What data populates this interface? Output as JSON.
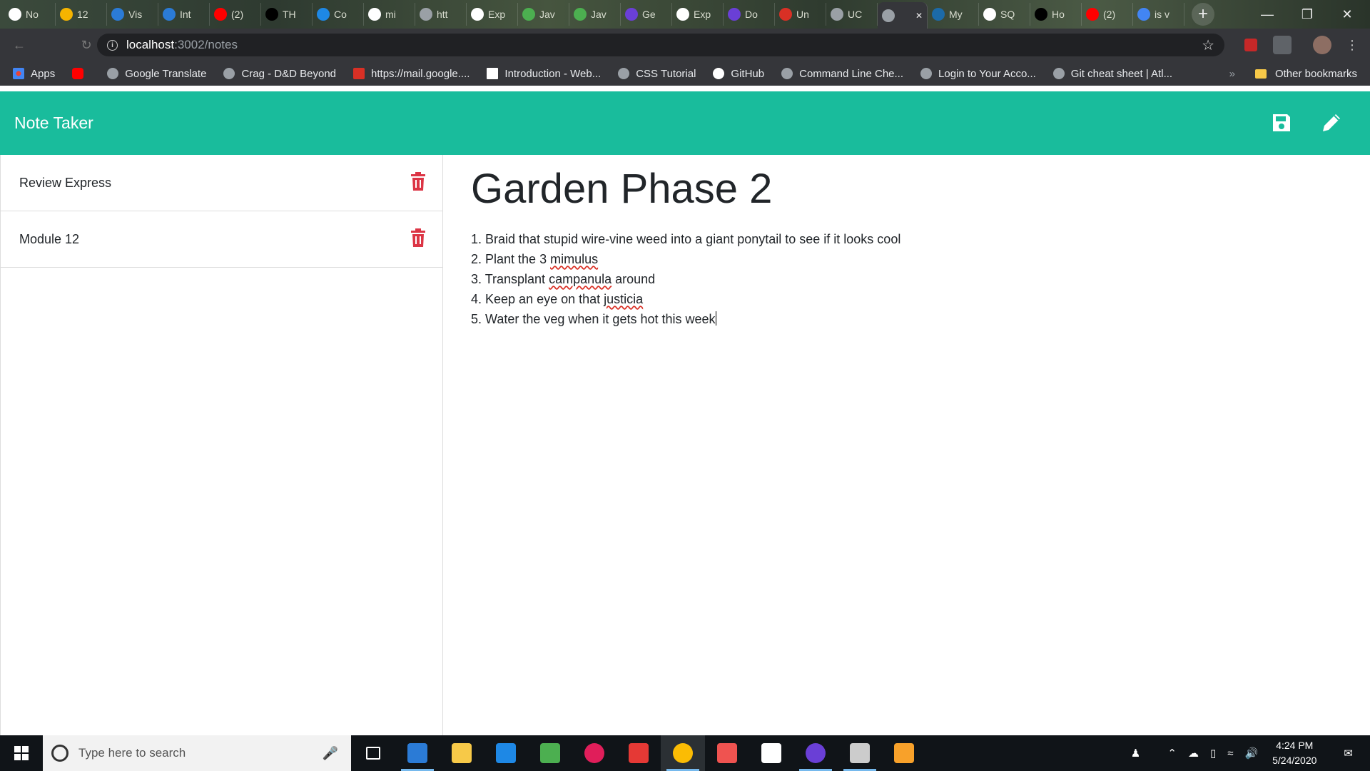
{
  "browser": {
    "tabs": [
      {
        "label": "No",
        "icon": "github-icon",
        "color": "#ffffff"
      },
      {
        "label": "12",
        "icon": "emoji-icon",
        "color": "#f5b400"
      },
      {
        "label": "Vis",
        "icon": "vscode-icon",
        "color": "#2b7bd6"
      },
      {
        "label": "Int",
        "icon": "vscode-icon",
        "color": "#2b7bd6"
      },
      {
        "label": "(2)",
        "icon": "youtube-icon",
        "color": "#ff0000"
      },
      {
        "label": "TH",
        "icon": "medium-icon",
        "color": "#000000"
      },
      {
        "label": "Co",
        "icon": "vuetify-icon",
        "color": "#1e88e5"
      },
      {
        "label": "mi",
        "icon": "github-icon",
        "color": "#ffffff"
      },
      {
        "label": "htt",
        "icon": "globe-icon",
        "color": "#9aa0a6"
      },
      {
        "label": "Exp",
        "icon": "express-icon",
        "color": "#ffffff"
      },
      {
        "label": "Jav",
        "icon": "w3-icon",
        "color": "#4caf50"
      },
      {
        "label": "Jav",
        "icon": "w3-icon",
        "color": "#4caf50"
      },
      {
        "label": "Ge",
        "icon": "purple-circle-icon",
        "color": "#6a3fd6"
      },
      {
        "label": "Exp",
        "icon": "express-icon",
        "color": "#ffffff"
      },
      {
        "label": "Do",
        "icon": "purple-circle-icon",
        "color": "#6a3fd6"
      },
      {
        "label": "Un",
        "icon": "gmail-icon",
        "color": "#d93025"
      },
      {
        "label": "UC",
        "icon": "blank-icon",
        "color": "#9aa0a6"
      },
      {
        "label": "",
        "icon": "loading-icon",
        "color": "#9aa0a6",
        "active": true
      },
      {
        "label": "My",
        "icon": "mysql-icon",
        "color": "#1c6aa8"
      },
      {
        "label": "SQ",
        "icon": "sql-icon",
        "color": "#ffffff"
      },
      {
        "label": "Ho",
        "icon": "htg-icon",
        "color": "#000000"
      },
      {
        "label": "(2)",
        "icon": "youtube-icon",
        "color": "#ff0000"
      },
      {
        "label": "is v",
        "icon": "google-icon",
        "color": "#4285f4"
      }
    ],
    "url_host": "localhost",
    "url_path": ":3002/notes",
    "bookmarks": [
      {
        "label": "Apps",
        "icon": "apps-grid-icon"
      },
      {
        "label": "",
        "icon": "youtube-icon"
      },
      {
        "label": "Google Translate",
        "icon": "globe-icon"
      },
      {
        "label": "Crag - D&D Beyond",
        "icon": "globe-icon"
      },
      {
        "label": "https://mail.google....",
        "icon": "gmail-icon"
      },
      {
        "label": "Introduction - Web...",
        "icon": "page-icon"
      },
      {
        "label": "CSS Tutorial",
        "icon": "globe-icon"
      },
      {
        "label": "GitHub",
        "icon": "github-icon"
      },
      {
        "label": "Command Line Che...",
        "icon": "globe-icon"
      },
      {
        "label": "Login to Your Acco...",
        "icon": "globe-icon"
      },
      {
        "label": "Git cheat sheet | Atl...",
        "icon": "globe-icon"
      }
    ],
    "overflow_label": "»",
    "other_bookmarks": "Other bookmarks"
  },
  "app": {
    "title": "Note Taker",
    "accent": "#19bc9c",
    "delete_color": "#dc3545",
    "notes": [
      {
        "title": "Review Express"
      },
      {
        "title": "Module 12"
      }
    ],
    "active_note": {
      "title": "Garden Phase 2",
      "lines": [
        {
          "pre": "1. Braid that stupid wire-vine weed into a giant ponytail to see if it looks cool",
          "misspelled": "",
          "post": ""
        },
        {
          "pre": "2. Plant the 3 ",
          "misspelled": "mimulus",
          "post": ""
        },
        {
          "pre": "3. Transplant ",
          "misspelled": "campanula",
          "post": " around"
        },
        {
          "pre": "4. Keep an eye on that ",
          "misspelled": "justicia",
          "post": ""
        },
        {
          "pre": "5. Water the veg when it gets hot this week",
          "misspelled": "",
          "post": ""
        }
      ]
    }
  },
  "taskbar": {
    "search_placeholder": "Type here to search",
    "apps": [
      {
        "name": "task-view-icon",
        "color": "#ffffff"
      },
      {
        "name": "vscode-icon",
        "color": "#2b7bd6",
        "running": true
      },
      {
        "name": "file-explorer-icon",
        "color": "#f7c948"
      },
      {
        "name": "mail-icon",
        "color": "#1e88e5"
      },
      {
        "name": "gitkraken-icon",
        "color": "#4caf50"
      },
      {
        "name": "slack-icon",
        "color": "#e01e5a"
      },
      {
        "name": "snip-icon",
        "color": "#e53935"
      },
      {
        "name": "chrome-icon",
        "color": "#fbbc04",
        "running": true,
        "active": true
      },
      {
        "name": "paint-icon",
        "color": "#ef5350"
      },
      {
        "name": "tidal-icon",
        "color": "#ffffff"
      },
      {
        "name": "purple-app-icon",
        "color": "#6a3fd6",
        "running": true
      },
      {
        "name": "terminal-icon",
        "color": "#cccccc",
        "running": true
      },
      {
        "name": "paint3d-icon",
        "color": "#f8a12a"
      }
    ],
    "time": "4:24 PM",
    "date": "5/24/2020"
  }
}
